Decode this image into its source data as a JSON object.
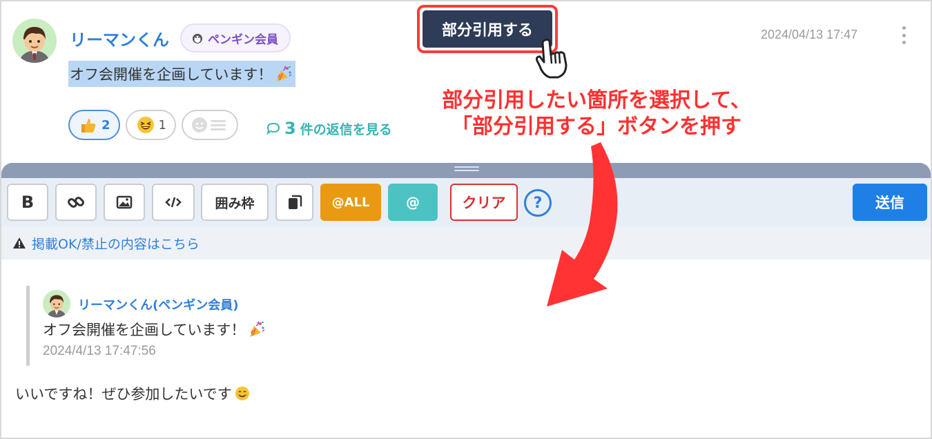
{
  "message": {
    "username": "リーマンくん",
    "badge": "ペンギン会員",
    "timestamp": "2024/04/13 17:47",
    "text": "オフ会開催を企画しています！",
    "reactions": [
      {
        "icon": "thumbs-up-icon",
        "count": "2",
        "active": true
      },
      {
        "icon": "laughing-face-icon",
        "count": "1",
        "active": false
      }
    ],
    "reply_count": "3",
    "reply_label": "件の返信を見る"
  },
  "tooltip": {
    "quote_button": "部分引用する"
  },
  "annotation": {
    "line1": "部分引用したい箇所を選択して、",
    "line2": "「部分引用する」ボタンを押す"
  },
  "toolbar": {
    "bold": "B",
    "frame": "囲み枠",
    "all": "@ALL",
    "at": "@",
    "clear": "クリア",
    "help": "?",
    "send": "送信"
  },
  "notice": {
    "text": "掲載OK/禁止の内容はこちら"
  },
  "editor": {
    "quote_name": "リーマンくん(ペンギン会員)",
    "quote_text": "オフ会開催を企画しています！",
    "quote_date": "2024/4/13 17:47:56",
    "reply_text": "いいですね！ぜひ参加したいです"
  },
  "colors": {
    "accent": "#2f7fdc",
    "annotation": "#ff3030",
    "send": "#1e7fe6",
    "all_button": "#e99a12",
    "at_button": "#4cc3c2"
  }
}
